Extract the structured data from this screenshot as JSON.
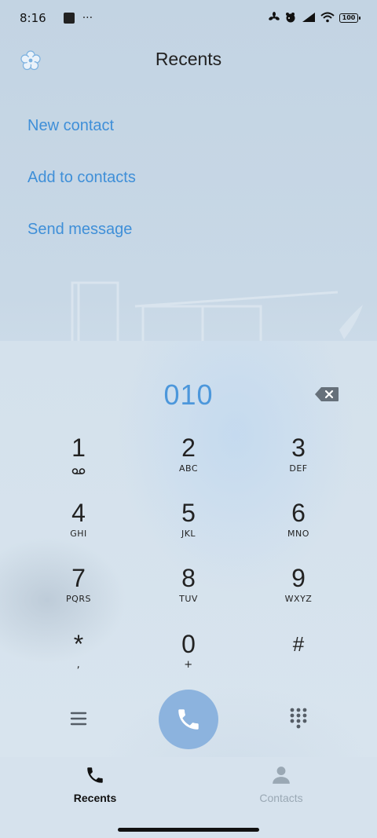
{
  "status_bar": {
    "time": "8:16",
    "overflow": "···",
    "battery": "100"
  },
  "header": {
    "title": "Recents",
    "settings_icon": "flower-settings-icon"
  },
  "actions": [
    {
      "label": "New contact"
    },
    {
      "label": "Add to contacts"
    },
    {
      "label": "Send message"
    }
  ],
  "dialer": {
    "number": "010",
    "keys": [
      {
        "digit": "1",
        "letters": ""
      },
      {
        "digit": "2",
        "letters": "ABC"
      },
      {
        "digit": "3",
        "letters": "DEF"
      },
      {
        "digit": "4",
        "letters": "GHI"
      },
      {
        "digit": "5",
        "letters": "JKL"
      },
      {
        "digit": "6",
        "letters": "MNO"
      },
      {
        "digit": "7",
        "letters": "PQRS"
      },
      {
        "digit": "8",
        "letters": "TUV"
      },
      {
        "digit": "9",
        "letters": "WXYZ"
      },
      {
        "digit": "*",
        "letters": ","
      },
      {
        "digit": "0",
        "letters": "+"
      },
      {
        "digit": "#",
        "letters": ""
      }
    ]
  },
  "tabs": [
    {
      "label": "Recents",
      "icon": "phone-icon",
      "active": true
    },
    {
      "label": "Contacts",
      "icon": "person-icon",
      "active": false
    }
  ],
  "colors": {
    "accent": "#3f8fd8",
    "number": "#4c97db",
    "call_button": "#8cb3de",
    "inactive_tab": "#9aa8b4"
  }
}
